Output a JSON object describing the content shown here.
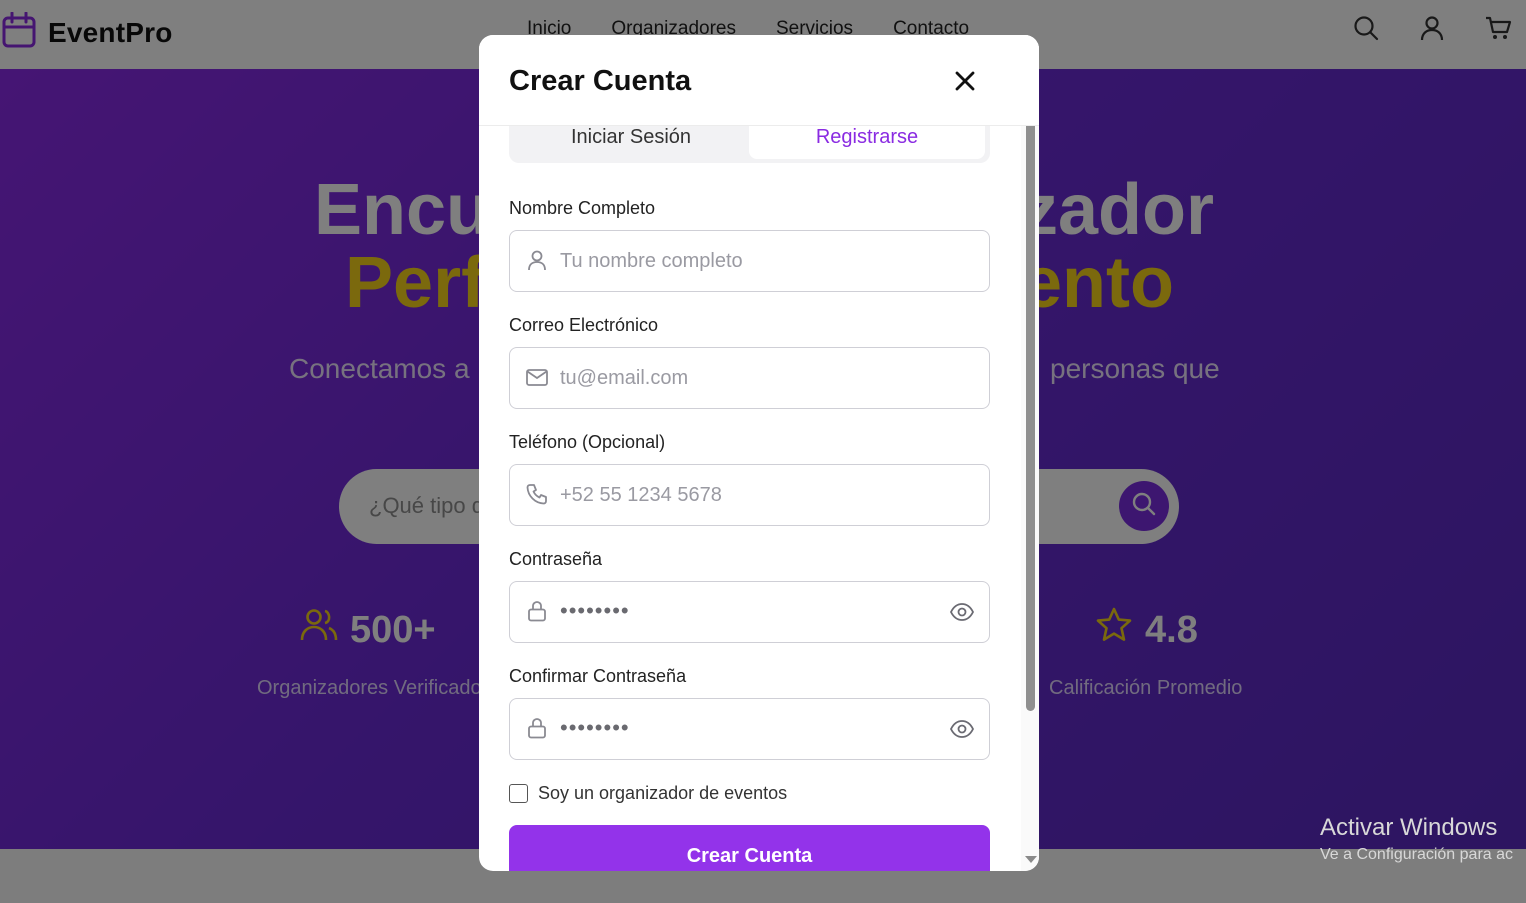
{
  "brand": {
    "name": "EventPro",
    "accent": "#8a2be2"
  },
  "nav": {
    "links": [
      "Inicio",
      "Organizadores",
      "Servicios",
      "Contacto"
    ],
    "icons": [
      "search-icon",
      "user-icon",
      "cart-icon"
    ]
  },
  "hero": {
    "line1_left": "Encu",
    "line1_right": "zador",
    "line2_left": "Perf",
    "line2_right": "ento",
    "subtitle_left": "Conectamos a",
    "subtitle_right": "personas que",
    "search_placeholder": "¿Qué tipo d",
    "stats": [
      {
        "value": "500+",
        "label": "Organizadores Verificado",
        "icon": "users-icon"
      },
      {
        "value": "4.8",
        "label": "Calificación Promedio",
        "icon": "star-icon"
      }
    ]
  },
  "modal": {
    "title": "Crear Cuenta",
    "tabs": {
      "login": "Iniciar Sesión",
      "register": "Registrarse",
      "active": "register"
    },
    "fields": {
      "name": {
        "label": "Nombre Completo",
        "placeholder": "Tu nombre completo"
      },
      "email": {
        "label": "Correo Electrónico",
        "placeholder": "tu@email.com"
      },
      "phone": {
        "label": "Teléfono (Opcional)",
        "placeholder": "+52 55 1234 5678"
      },
      "password": {
        "label": "Contraseña",
        "value": "••••••••"
      },
      "confirm": {
        "label": "Confirmar Contraseña",
        "value": "••••••••"
      }
    },
    "organizer_checkbox": {
      "label": "Soy un organizador de eventos",
      "checked": false
    },
    "submit_label": "Crear Cuenta"
  },
  "watermark": {
    "line1": "Activar Windows",
    "line2": "Ve a Configuración para ac"
  }
}
